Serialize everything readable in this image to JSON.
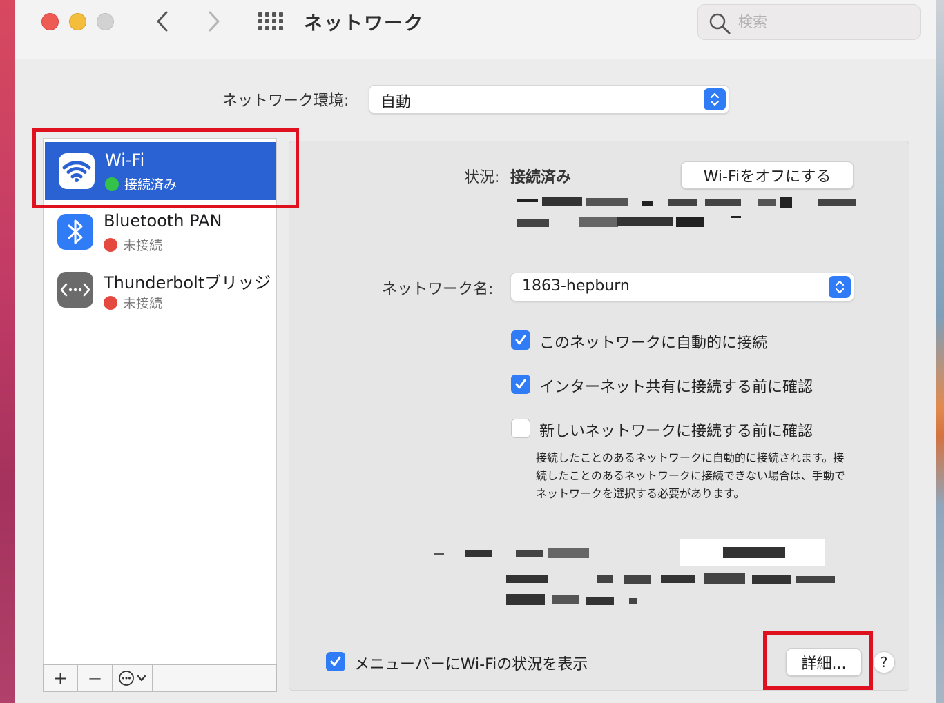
{
  "window": {
    "title": "ネットワーク"
  },
  "search": {
    "placeholder": "検索"
  },
  "location": {
    "label": "ネットワーク環境:",
    "value": "自動"
  },
  "services": [
    {
      "name": "Wi-Fi",
      "status": "接続済み",
      "status_color": "#35c24a",
      "icon": "wifi-icon",
      "selected": true
    },
    {
      "name": "Bluetooth PAN",
      "status": "未接続",
      "status_color": "#e5483f",
      "icon": "bluetooth-icon",
      "selected": false
    },
    {
      "name": "Thunderboltブリッジ",
      "status": "未接続",
      "status_color": "#e5483f",
      "icon": "thunderbolt-bridge-icon",
      "selected": false
    }
  ],
  "toolbar": {
    "add": "+",
    "remove": "—"
  },
  "detail": {
    "status_label": "状況:",
    "status_value": "接続済み",
    "wifi_off_button": "Wi-Fiをオフにする",
    "network_name_label": "ネットワーク名:",
    "network_name_value": "1863-hepburn",
    "auto_join_label": "このネットワークに自動的に接続",
    "auto_join_checked": true,
    "hotspot_confirm_label": "インターネット共有に接続する前に確認",
    "hotspot_confirm_checked": true,
    "new_network_confirm_label": "新しいネットワークに接続する前に確認",
    "new_network_confirm_checked": false,
    "description": "接続したことのあるネットワークに自動的に接続されます。接続したことのあるネットワークに接続できない場合は、手動でネットワークを選択する必要があります。",
    "menubar_label": "メニューバーにWi-Fiの状況を表示",
    "menubar_checked": true,
    "advanced_button": "詳細...",
    "help_button": "?"
  },
  "colors": {
    "accent": "#2f7cf6",
    "selection": "#2a62d4",
    "highlight": "#e0111f"
  }
}
